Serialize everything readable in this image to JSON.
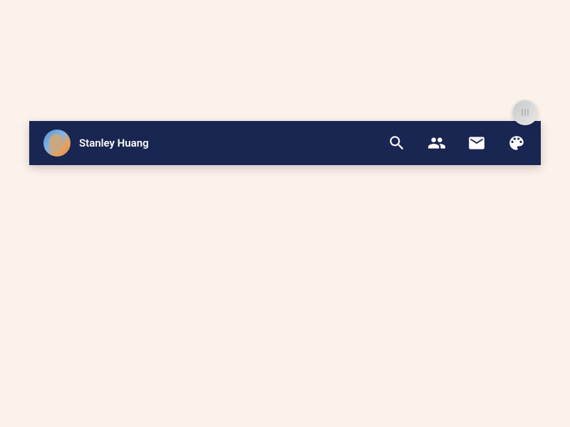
{
  "navbar": {
    "username": "Stanley Huang",
    "avatar": "user-avatar",
    "icons": {
      "search": "search-icon",
      "friends": "friends-icon",
      "messages": "messages-icon",
      "palette": "palette-icon"
    }
  },
  "colors": {
    "background": "#fcf2ec",
    "navbar": "#1a2652",
    "text": "#ffffff"
  }
}
